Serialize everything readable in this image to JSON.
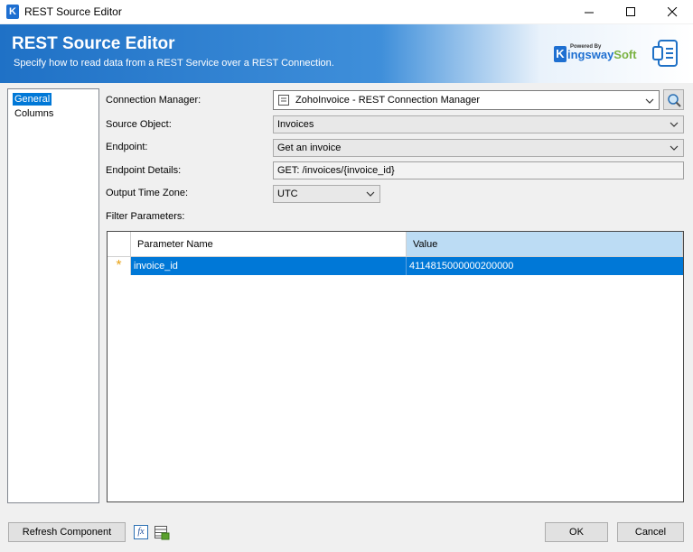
{
  "window": {
    "title": "REST Source Editor",
    "app_icon_letter": "K"
  },
  "banner": {
    "title": "REST Source Editor",
    "subtitle": "Specify how to read data from a REST Service over a REST Connection.",
    "logo_powered_by": "Powered By",
    "logo_k": "K",
    "logo_ingsway": "ingsway",
    "logo_soft": "Soft"
  },
  "nav": {
    "items": [
      {
        "label": "General",
        "selected": true
      },
      {
        "label": "Columns",
        "selected": false
      }
    ]
  },
  "form": {
    "connection_manager_label": "Connection Manager:",
    "connection_manager_value": "ZohoInvoice - REST Connection Manager",
    "source_object_label": "Source Object:",
    "source_object_value": "Invoices",
    "endpoint_label": "Endpoint:",
    "endpoint_value": "Get an invoice",
    "endpoint_details_label": "Endpoint Details:",
    "endpoint_details_value": "GET: /invoices/{invoice_id}",
    "output_tz_label": "Output Time Zone:",
    "output_tz_value": "UTC",
    "filter_params_label": "Filter Parameters:"
  },
  "grid": {
    "columns": [
      "Parameter Name",
      "Value"
    ],
    "rows": [
      {
        "marker": "*",
        "name": "invoice_id",
        "value": "4114815000000200000"
      }
    ]
  },
  "footer": {
    "refresh_label": "Refresh Component",
    "fx_label": "fx",
    "ok_label": "OK",
    "cancel_label": "Cancel"
  },
  "colors": {
    "accent": "#0078d7",
    "banner_blue": "#1f71c6",
    "brand_green": "#7ab241"
  }
}
